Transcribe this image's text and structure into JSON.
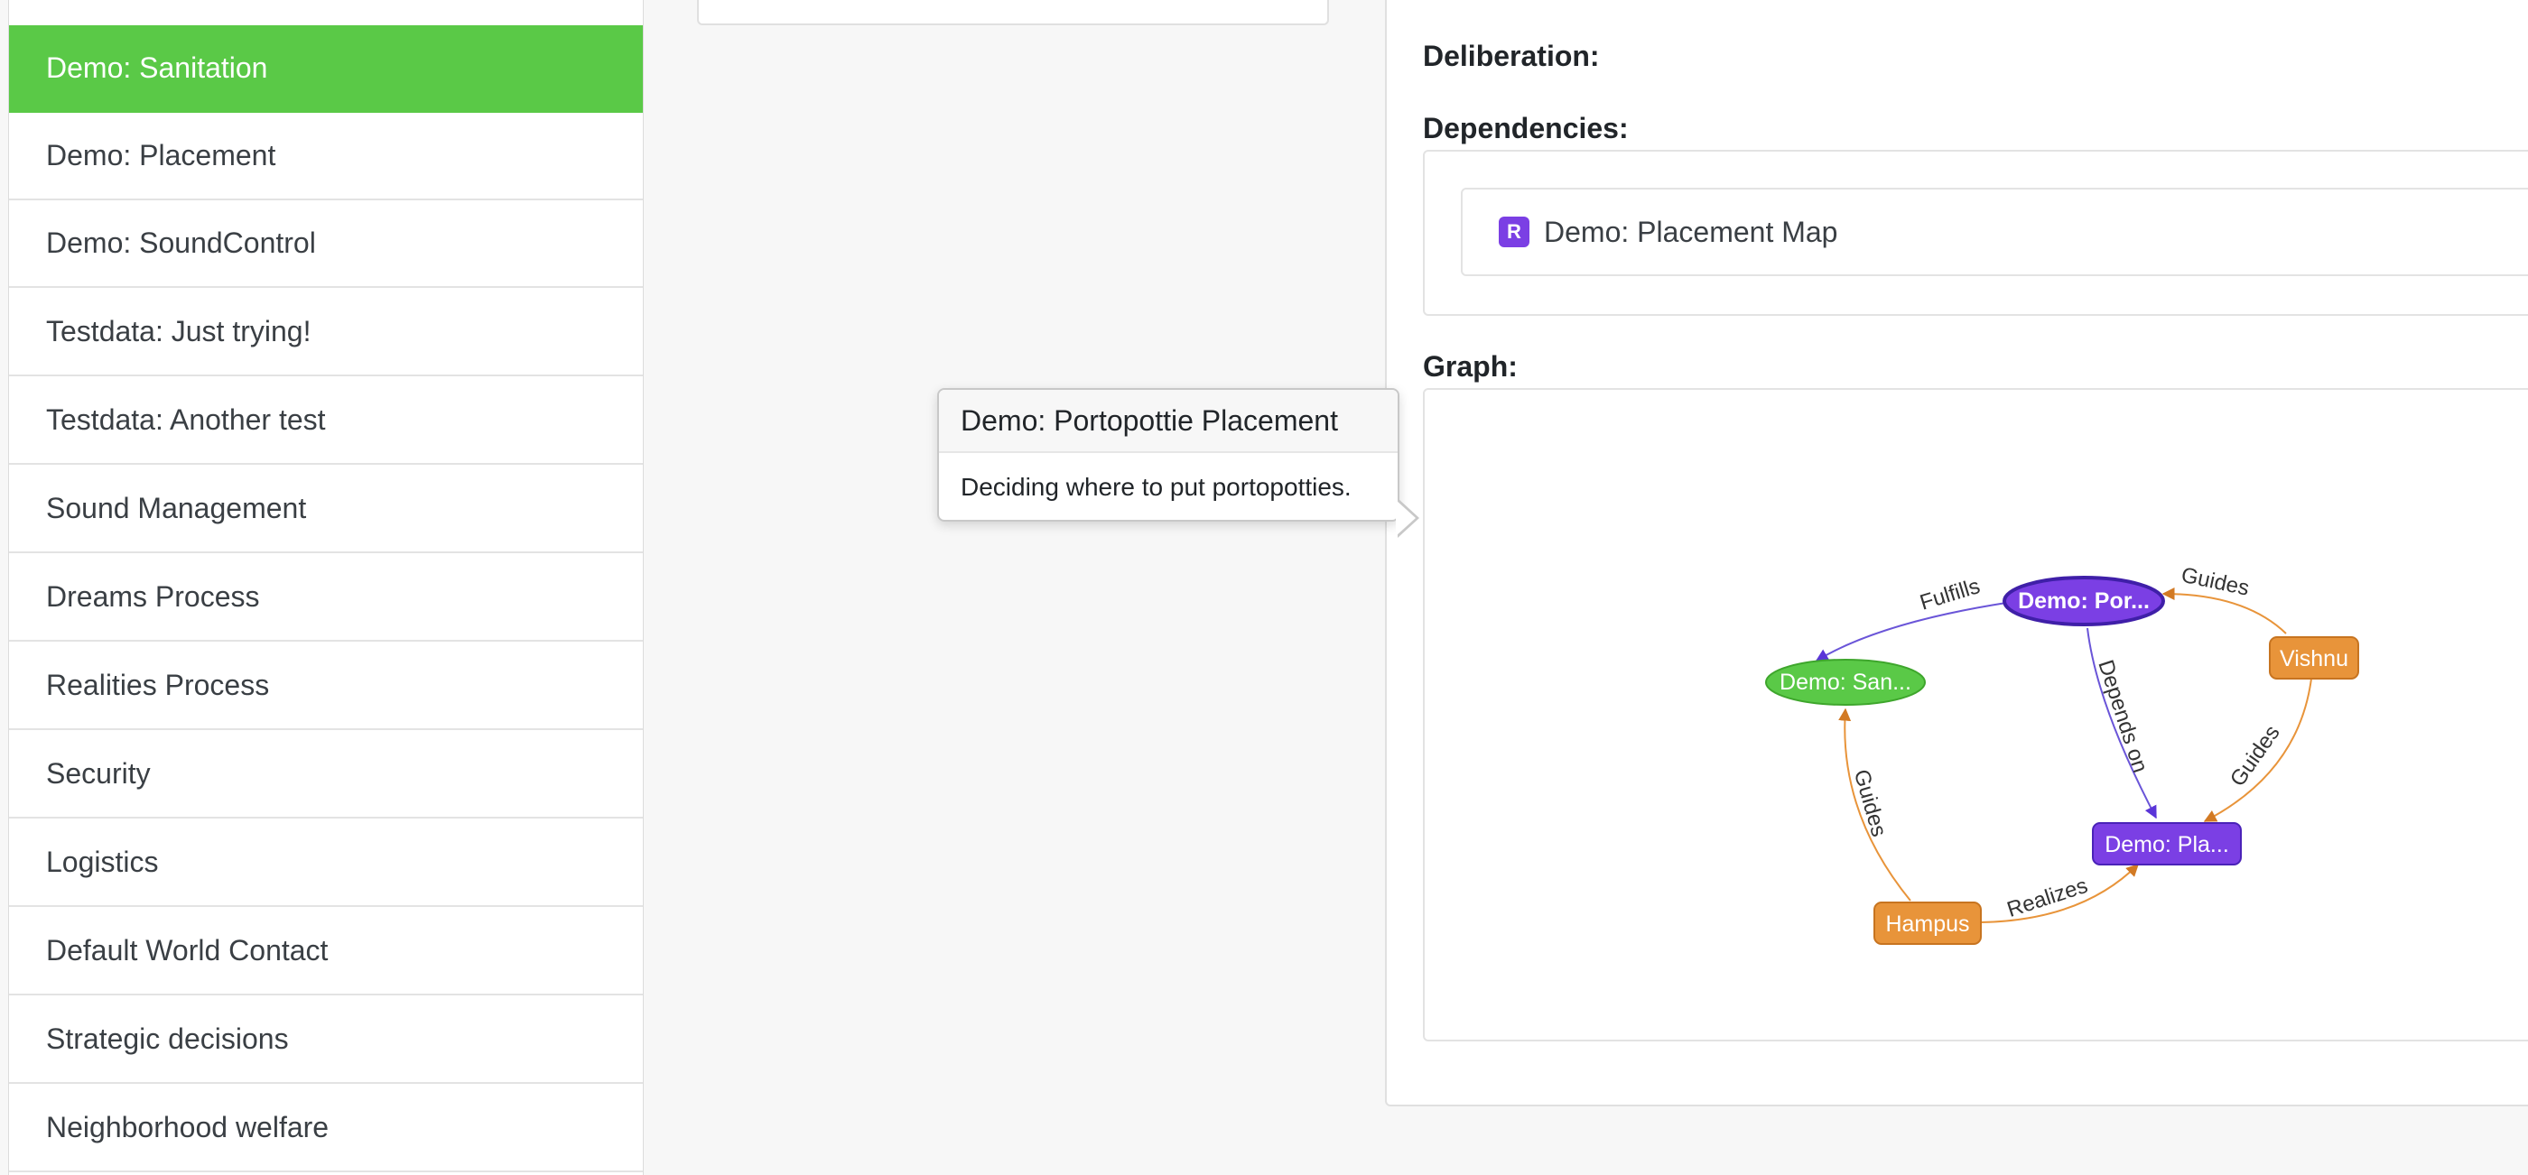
{
  "sidebar": {
    "items": [
      {
        "label": "Demo: Sanitation",
        "active": true
      },
      {
        "label": "Demo: Placement"
      },
      {
        "label": "Demo: SoundControl"
      },
      {
        "label": "Testdata: Just trying!"
      },
      {
        "label": "Testdata: Another test"
      },
      {
        "label": "Sound Management"
      },
      {
        "label": "Dreams Process"
      },
      {
        "label": "Realities Process"
      },
      {
        "label": "Security"
      },
      {
        "label": "Logistics"
      },
      {
        "label": "Default World Contact"
      },
      {
        "label": "Strategic decisions"
      },
      {
        "label": "Neighborhood welfare"
      }
    ]
  },
  "detail": {
    "deliberation_label": "Deliberation:",
    "dependencies_label": "Dependencies:",
    "dependency": {
      "badge": "R",
      "label": "Demo: Placement Map"
    },
    "graph_label": "Graph:"
  },
  "popover": {
    "title": "Demo: Portopottie Placement",
    "body": "Deciding where to put portopotties."
  },
  "graph": {
    "colors": {
      "purple": "#7b3fe4",
      "green": "#5ac947",
      "orange": "#e8943a"
    },
    "nodes": [
      {
        "id": "portopottie",
        "label": "Demo: Por...",
        "shape": "ellipse",
        "color": "#7b3fe4"
      },
      {
        "id": "sanitation",
        "label": "Demo: San...",
        "shape": "ellipse",
        "color": "#5ac947"
      },
      {
        "id": "vishnu",
        "label": "Vishnu",
        "shape": "box",
        "color": "#e8943a"
      },
      {
        "id": "placement",
        "label": "Demo: Pla...",
        "shape": "box",
        "color": "#7b3fe4"
      },
      {
        "id": "hampus",
        "label": "Hampus",
        "shape": "box",
        "color": "#e8943a"
      }
    ],
    "edges": [
      {
        "from": "portopottie",
        "to": "sanitation",
        "label": "Fulfills"
      },
      {
        "from": "vishnu",
        "to": "portopottie",
        "label": "Guides"
      },
      {
        "from": "portopottie",
        "to": "placement",
        "label": "Depends on"
      },
      {
        "from": "vishnu",
        "to": "placement",
        "label": "Guides"
      },
      {
        "from": "hampus",
        "to": "sanitation",
        "label": "Guides"
      },
      {
        "from": "hampus",
        "to": "placement",
        "label": "Realizes"
      }
    ]
  }
}
